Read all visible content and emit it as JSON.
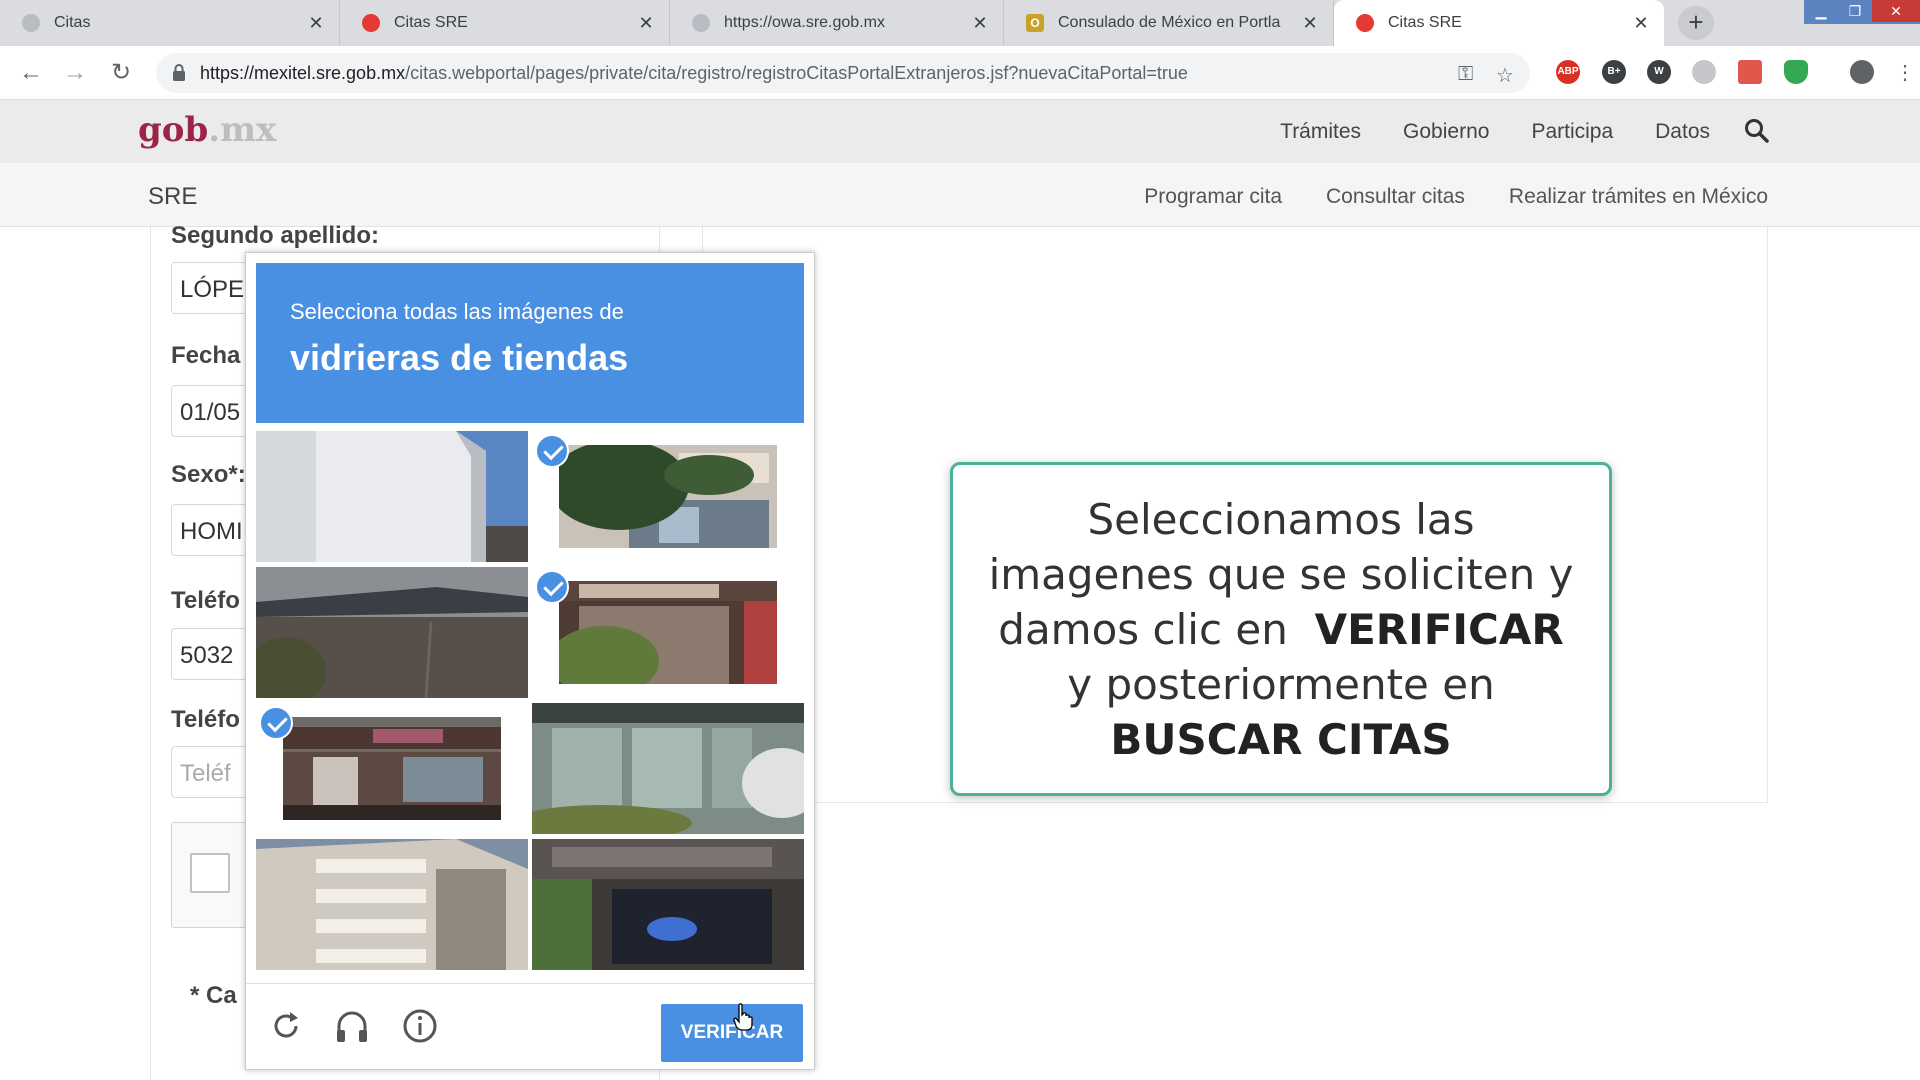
{
  "browser": {
    "tabs": [
      {
        "title": "Citas",
        "favicon": "grey"
      },
      {
        "title": "Citas SRE",
        "favicon": "red"
      },
      {
        "title": "https://owa.sre.gob.mx",
        "favicon": "grey"
      },
      {
        "title": "Consulado de México en Portla",
        "favicon": "outlook"
      },
      {
        "title": "Citas SRE",
        "favicon": "red",
        "active": true
      }
    ],
    "url_host": "https://mexitel.sre.gob.mx",
    "url_path": "/citas.webportal/pages/private/cita/registro/registroCitasPortalExtranjeros.jsf?nuevaCitaPortal=true",
    "extensions": [
      "ABP",
      "B+",
      "W",
      "",
      "",
      ""
    ]
  },
  "site": {
    "logo_main": "gob",
    "logo_ext": ".mx",
    "menu": [
      "Trámites",
      "Gobierno",
      "Participa",
      "Datos"
    ],
    "section": "SRE",
    "section_links": [
      "Programar cita",
      "Consultar citas",
      "Realizar trámites en México"
    ]
  },
  "form": {
    "segundo_apellido_label": "Segundo apellido:",
    "segundo_apellido_value": "LÓPE",
    "fecha_label": "Fecha",
    "fecha_value": "01/05",
    "sexo_label": "Sexo*:",
    "sexo_value": "HOMI",
    "telefono1_label": "Teléfo",
    "telefono1_value": "5032",
    "telefono2_label": "Teléfo",
    "telefono2_placeholder": "Teléf",
    "footnote": "* Ca"
  },
  "captcha": {
    "instruction": "Selecciona todas las imágenes de",
    "object": "vidrieras de tiendas",
    "tiles": [
      {
        "selected": false,
        "scene": "white-wall"
      },
      {
        "selected": true,
        "scene": "tree-storefront"
      },
      {
        "selected": false,
        "scene": "dark-building"
      },
      {
        "selected": true,
        "scene": "barbers-shop"
      },
      {
        "selected": true,
        "scene": "shop-front"
      },
      {
        "selected": false,
        "scene": "glass-wall-car"
      },
      {
        "selected": false,
        "scene": "balcony-building"
      },
      {
        "selected": false,
        "scene": "korean-sign-shop"
      }
    ],
    "verify_label": "VERIFICAR"
  },
  "callout": {
    "line1": "Seleccionamos las",
    "line2": "imagenes que se soliciten y",
    "line3_pre": "damos clic en",
    "line3_bold": "VERIFICAR",
    "line4": "y posteriormente en",
    "line5_bold": "BUSCAR CITAS"
  },
  "colors": {
    "gob_brand": "#9d2449",
    "captcha_blue": "#4a90e2",
    "callout_border": "#4fb09a"
  }
}
